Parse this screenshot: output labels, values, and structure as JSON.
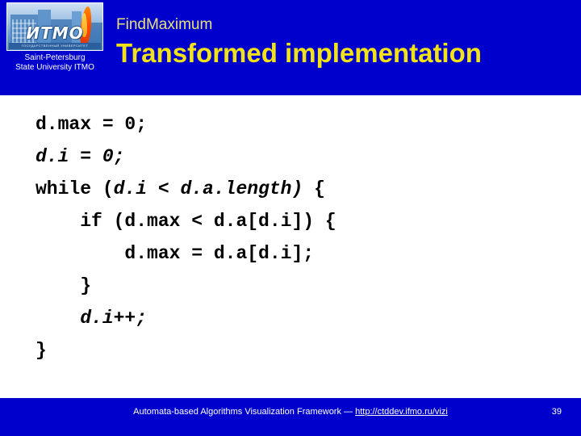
{
  "colors": {
    "header_bg": "#0000CC",
    "footer_bg": "#0000CC",
    "body_bg": "#FFFFFF",
    "subtitle": "#E8E07A",
    "title": "#F2E318",
    "code": "#000000",
    "footer_text": "#FFFFFF"
  },
  "header": {
    "logo": {
      "emblem_word": "ИТМО",
      "emblem_strip": "ГОСУДАРСТВЕННЫЙ УНИВЕРСИТЕТ",
      "caption_line1": "Saint-Petersburg",
      "caption_line2": "State University ITMO"
    },
    "subtitle": "FindMaximum",
    "title": "Transformed implementation"
  },
  "code": {
    "lines": [
      {
        "indent": 0,
        "segments": [
          {
            "text": "d.max = 0;",
            "italic": false
          }
        ]
      },
      {
        "indent": 0,
        "segments": [
          {
            "text": "d.i = 0;",
            "italic": true
          }
        ]
      },
      {
        "indent": 0,
        "segments": [
          {
            "text": "while (",
            "italic": false
          },
          {
            "text": "d.i < d.a.length)",
            "italic": true
          },
          {
            "text": " {",
            "italic": false
          }
        ]
      },
      {
        "indent": 4,
        "segments": [
          {
            "text": "if (d.max < d.a[d.i]) {",
            "italic": false
          }
        ]
      },
      {
        "indent": 8,
        "segments": [
          {
            "text": "d.max = d.a[d.i];",
            "italic": false
          }
        ]
      },
      {
        "indent": 4,
        "segments": [
          {
            "text": "}",
            "italic": false
          }
        ]
      },
      {
        "indent": 4,
        "segments": [
          {
            "text": "d.i++;",
            "italic": true
          }
        ]
      },
      {
        "indent": 0,
        "segments": [
          {
            "text": "}",
            "italic": false
          }
        ]
      }
    ]
  },
  "footer": {
    "text": "Automata-based Algorithms Visualization Framework — ",
    "link": "http://ctddev.ifmo.ru/vizi",
    "page_number": "39"
  }
}
